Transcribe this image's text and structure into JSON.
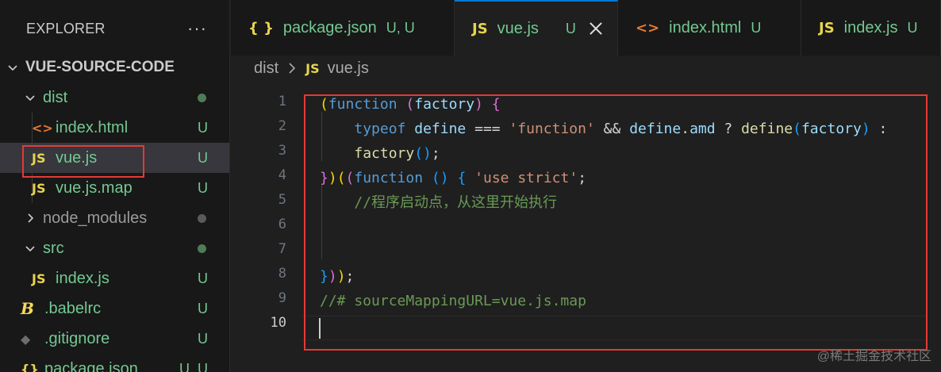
{
  "explorer": {
    "title": "EXPLORER",
    "more": "···",
    "root": "VUE-SOURCE-CODE",
    "items": [
      {
        "label": "dist",
        "status": ""
      },
      {
        "label": "index.html",
        "status": "U",
        "icon": "<>"
      },
      {
        "label": "vue.js",
        "status": "U",
        "icon": "JS"
      },
      {
        "label": "vue.js.map",
        "status": "U",
        "icon": "JS"
      },
      {
        "label": "node_modules",
        "status": ""
      },
      {
        "label": "src",
        "status": ""
      },
      {
        "label": "index.js",
        "status": "U",
        "icon": "JS"
      },
      {
        "label": ".babelrc",
        "status": "U",
        "icon": "B"
      },
      {
        "label": ".gitignore",
        "status": "U",
        "icon": "◆"
      },
      {
        "label": "package.json",
        "status": "U, U",
        "icon": "{}"
      }
    ]
  },
  "tabs": [
    {
      "icon": "{ }",
      "name": "package.json",
      "status": "U, U"
    },
    {
      "icon": "JS",
      "name": "vue.js",
      "status": "U"
    },
    {
      "icon": "<>",
      "name": "index.html",
      "status": "U"
    },
    {
      "icon": "JS",
      "name": "index.js",
      "status": "U"
    }
  ],
  "breadcrumb": {
    "folder": "dist",
    "icon": "JS",
    "file": "vue.js"
  },
  "line_numbers": [
    "1",
    "2",
    "3",
    "4",
    "5",
    "6",
    "7",
    "8",
    "9",
    "10"
  ],
  "code_comment_line5": "//程序启动点，从这里开始执行",
  "code_comment_line9": "//# sourceMappingURL=vue.js.map",
  "watermark": "@稀土掘金技术社区",
  "colors": {
    "modified": "#73c991",
    "accent": "#0078d4",
    "highlight": "#e53935"
  }
}
